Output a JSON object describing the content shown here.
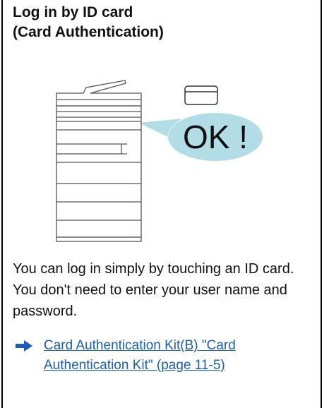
{
  "section": {
    "title_line1": "Log in by ID card",
    "title_line2": "(Card Authentication)"
  },
  "illustration": {
    "bubble_text": "OK !",
    "bubble_color": "#b3dde6"
  },
  "body": {
    "text": "You can log in simply by touching an ID card. You don't need to enter your user name and password."
  },
  "reference": {
    "link_text": "Card Authentication Kit(B) \"Card Authentication Kit\" (page 11-5)",
    "link_color": "#1a5fb4",
    "arrow_color": "#1a5fb4",
    "arrow_icon": "right-arrow-icon"
  }
}
